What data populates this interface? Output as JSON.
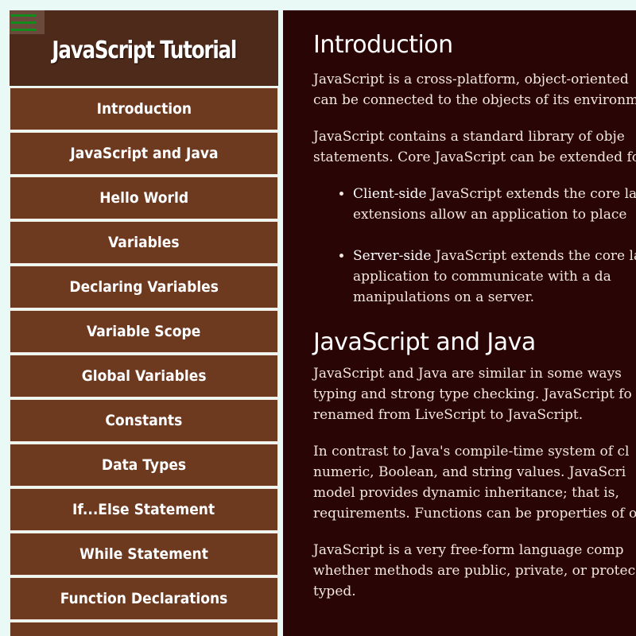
{
  "sidebar": {
    "title": "JavaScript Tutorial",
    "menu_icon": "hamburger-icon",
    "items": [
      "Introduction",
      "JavaScript and Java",
      "Hello World",
      "Variables",
      "Declaring Variables",
      "Variable Scope",
      "Global Variables",
      "Constants",
      "Data Types",
      "If...Else Statement",
      "While Statement",
      "Function Declarations",
      ""
    ]
  },
  "main": {
    "intro": {
      "heading": "Introduction",
      "p1": [
        "JavaScript is a cross-platform, object-oriented",
        "can be connected to the objects of its environm"
      ],
      "p2": [
        "JavaScript contains a standard library of obje",
        "statements. Core JavaScript can be extended fo"
      ],
      "bullets": [
        {
          "term": "Client-side",
          "lines": [
            " JavaScript extends the core la",
            "extensions allow an application to place"
          ]
        },
        {
          "term": "Server-side",
          "lines": [
            " JavaScript extends the core la",
            "application  to  communicate  with  a  da",
            "manipulations on a server."
          ]
        }
      ]
    },
    "java": {
      "heading": "JavaScript and Java",
      "p1": [
        "JavaScript and Java are similar in some ways",
        "typing and strong type checking. JavaScript fo",
        "renamed from LiveScript to JavaScript."
      ],
      "p2": [
        "In contrast to Java's compile-time system of cl",
        "numeric, Boolean, and string values. JavaScri",
        "model provides dynamic inheritance; that is,",
        "requirements. Functions can be properties of o"
      ],
      "p3": [
        "JavaScript is a very free-form language comp",
        "whether methods are public, private, or protec",
        "typed."
      ]
    }
  },
  "colors": {
    "brand_bg": "#4e2a1a",
    "nav_bg": "#6d3a20",
    "main_bg": "#2a0505",
    "hamburger": "#138a1c"
  }
}
